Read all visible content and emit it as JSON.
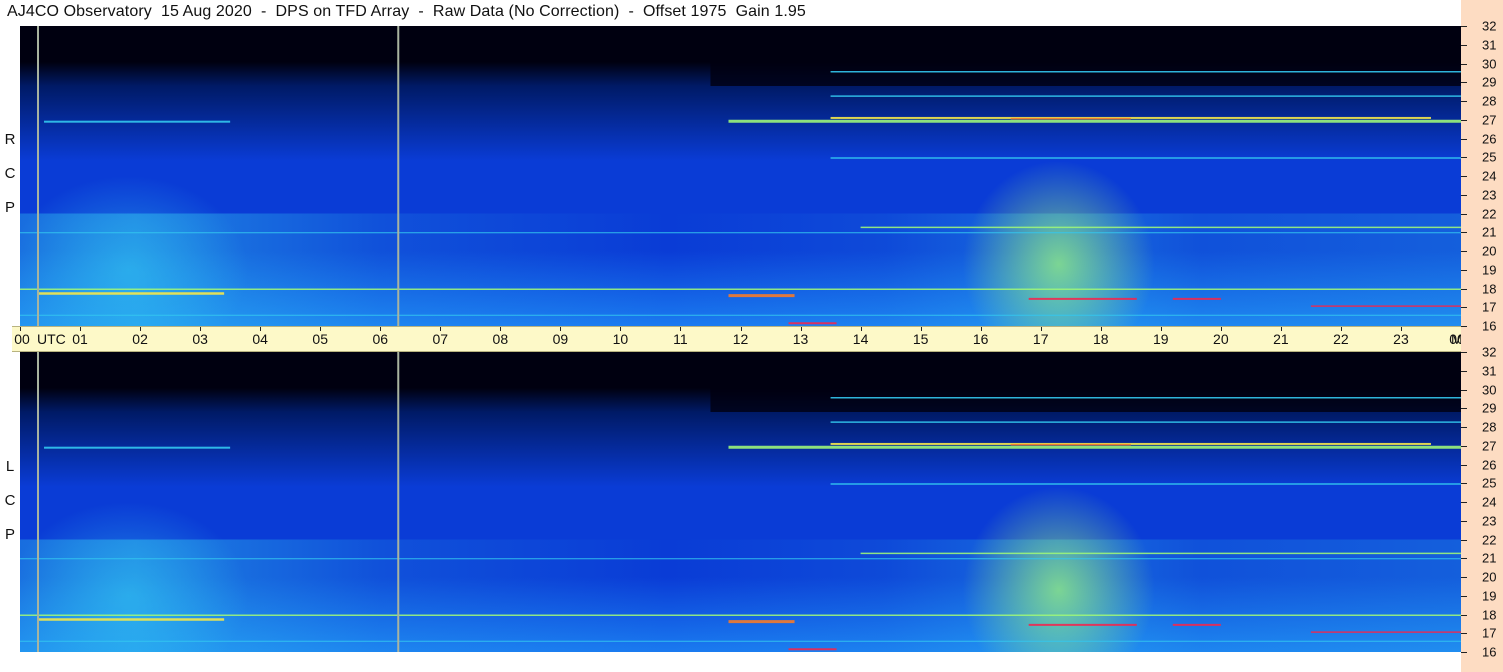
{
  "title": "AJ4CO Observatory  15 Aug 2020  -  DPS on TFD Array  -  Raw Data (No Correction)  -  Offset 1975  Gain 1.95",
  "panels": [
    {
      "id": "rcp",
      "label_letters": [
        "R",
        "C",
        "P"
      ]
    },
    {
      "id": "lcp",
      "label_letters": [
        "L",
        "C",
        "P"
      ]
    }
  ],
  "time_axis": {
    "unit_label": "UTC",
    "labels": [
      "00",
      "01",
      "02",
      "03",
      "04",
      "05",
      "06",
      "07",
      "08",
      "09",
      "10",
      "11",
      "12",
      "13",
      "14",
      "15",
      "16",
      "17",
      "18",
      "19",
      "20",
      "21",
      "22",
      "23",
      "00"
    ]
  },
  "freq_axis": {
    "unit_label": "MHz",
    "ticks": [
      32,
      31,
      30,
      29,
      28,
      27,
      26,
      25,
      24,
      23,
      22,
      21,
      20,
      19,
      18,
      17,
      16
    ]
  },
  "chart_data": {
    "type": "heatmap",
    "title": "AJ4CO Observatory  15 Aug 2020  -  DPS on TFD Array  -  Raw Data (No Correction)  -  Offset 1975  Gain 1.95",
    "x_axis": {
      "label": "UTC",
      "range": [
        "00:00",
        "24:00"
      ],
      "tick_labels": [
        "00",
        "01",
        "02",
        "03",
        "04",
        "05",
        "06",
        "07",
        "08",
        "09",
        "10",
        "11",
        "12",
        "13",
        "14",
        "15",
        "16",
        "17",
        "18",
        "19",
        "20",
        "21",
        "22",
        "23",
        "00"
      ]
    },
    "y_axis": {
      "label": "MHz",
      "range": [
        16,
        32
      ],
      "tick_labels": [
        16,
        17,
        18,
        19,
        20,
        21,
        22,
        23,
        24,
        25,
        26,
        27,
        28,
        29,
        30,
        31,
        32
      ]
    },
    "panels": [
      "RCP",
      "LCP"
    ],
    "markers_utc_hours": [
      0.3,
      6.3
    ],
    "colormap": [
      "#000010",
      "#001a66",
      "#0a3cd6",
      "#1a7af0",
      "#33c8f0",
      "#9cf57a",
      "#f5e84a",
      "#f57a2a",
      "#f02850"
    ]
  }
}
